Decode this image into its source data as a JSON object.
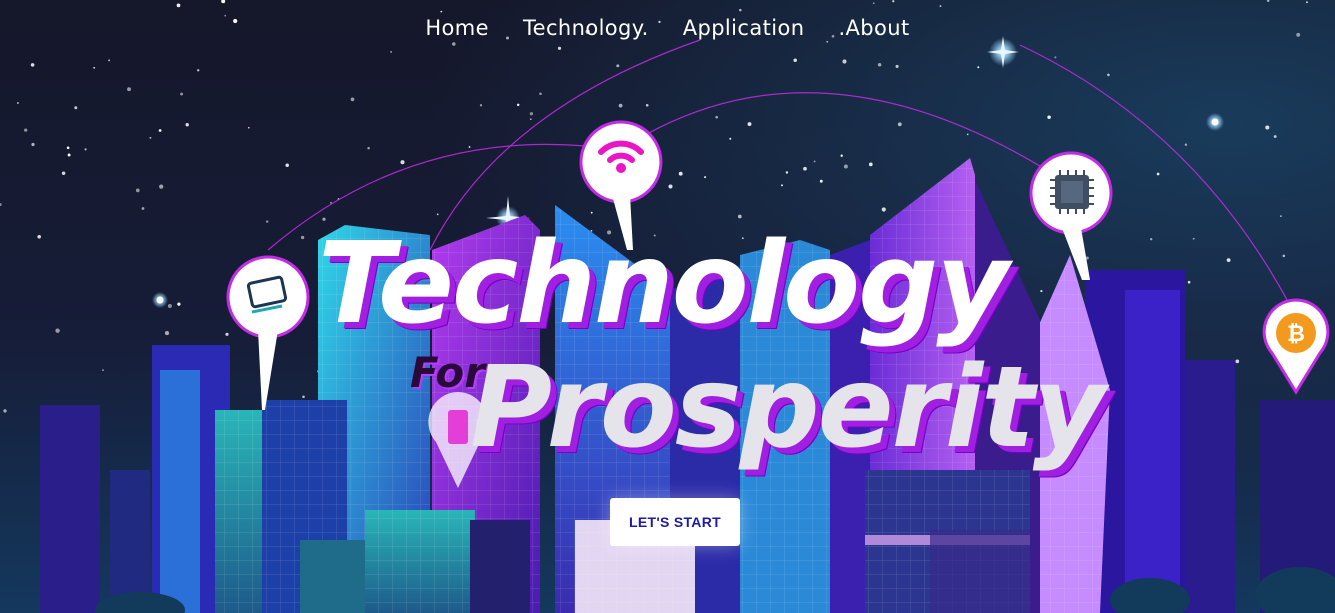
{
  "nav": {
    "items": [
      {
        "label": "Home"
      },
      {
        "label": "Technology."
      },
      {
        "label": "Application"
      },
      {
        "label": ".About"
      }
    ]
  },
  "hero": {
    "title_line1": "Technology",
    "title_small": "For",
    "title_line2": "Prosperity",
    "cta_label": "LET'S START"
  },
  "pins": {
    "bitcoin_symbol": "₿"
  },
  "colors": {
    "sky_top": "#171a2b",
    "sky_bottom": "#16305a",
    "accent_purple": "#a11fe0",
    "accent_magenta": "#e21bd6",
    "cta_text": "#1d1aa8"
  }
}
